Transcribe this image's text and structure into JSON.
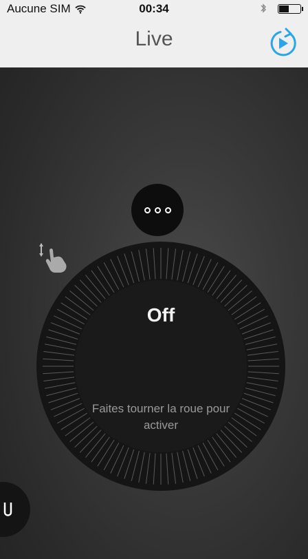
{
  "status_bar": {
    "carrier": "Aucune SIM",
    "time": "00:34",
    "battery_level": 0.48,
    "icons": [
      "wifi-icon",
      "bluetooth-icon",
      "battery-icon"
    ]
  },
  "nav": {
    "title": "Live",
    "right_icon": "replay-play-icon",
    "accent_color": "#2aa6e6"
  },
  "controls": {
    "more_icon": "three-dots-icon"
  },
  "wheel": {
    "value": "Off",
    "hint": "Faites tourner la roue pour activer",
    "icon": "hand-rotate-icon"
  },
  "colors": {
    "background": "#333333",
    "bar": "#efefef",
    "accent": "#2aa6e6"
  }
}
